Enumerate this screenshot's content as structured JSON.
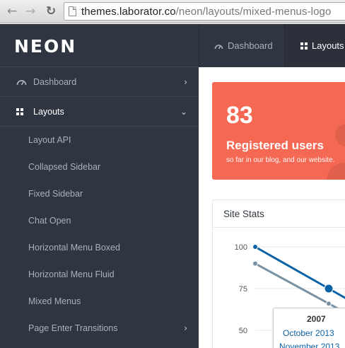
{
  "browser": {
    "url_main": "themes.laborator.co",
    "url_path": "/neon/layouts/mixed-menus-logo"
  },
  "logo": "NEON",
  "topnav": {
    "items": [
      {
        "label": "Dashboard",
        "icon": "gauge-icon"
      },
      {
        "label": "Layouts",
        "icon": "grid-icon"
      }
    ]
  },
  "sidebar": {
    "items": [
      {
        "label": "Dashboard",
        "icon": "gauge-icon"
      },
      {
        "label": "Layouts",
        "icon": "grid-icon"
      }
    ],
    "submenu": [
      "Layout API",
      "Collapsed Sidebar",
      "Fixed Sidebar",
      "Chat Open",
      "Horizontal Menu Boxed",
      "Horizontal Menu Fluid",
      "Mixed Menus",
      "Page Enter Transitions"
    ]
  },
  "tile": {
    "number": "83",
    "title": "Registered users",
    "subtitle": "so far in our blog, and our website."
  },
  "panel": {
    "title": "Site Stats"
  },
  "chart_data": {
    "type": "line",
    "y_ticks": [
      "100",
      "75",
      "50"
    ],
    "series": [
      {
        "values": [
          100,
          75
        ],
        "color": "#0b62a4"
      },
      {
        "values": [
          90,
          66
        ],
        "color": "#7a92a3"
      }
    ],
    "tooltip": {
      "title": "2007",
      "lines": [
        "October 2013",
        "November 2013"
      ]
    }
  },
  "colors": {
    "sidebar_bg": "#303641",
    "tile_bg": "#f56954",
    "series_primary": "#0b62a4",
    "series_secondary": "#7a92a3"
  }
}
